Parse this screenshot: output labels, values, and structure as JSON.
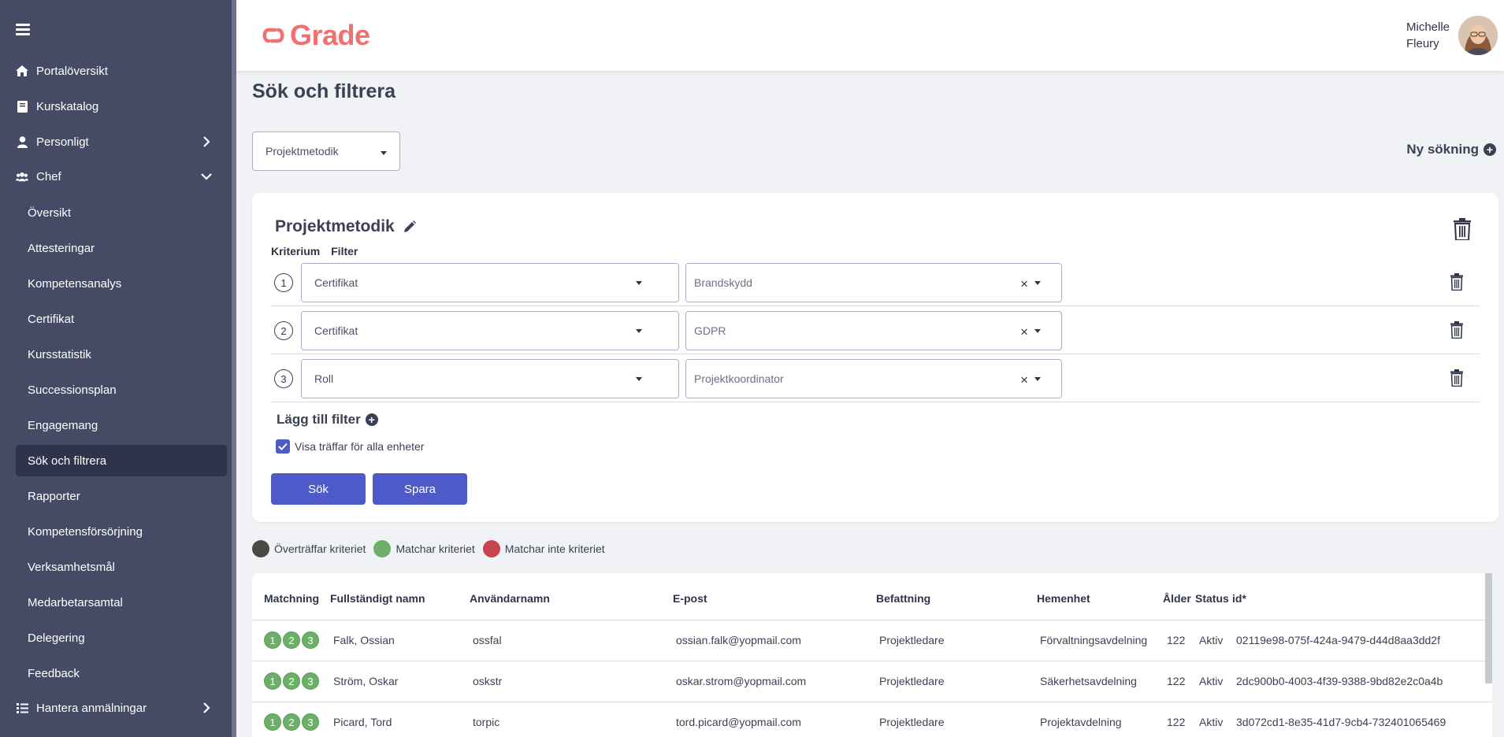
{
  "sidebar": {
    "items": [
      {
        "label": "Portalöversikt"
      },
      {
        "label": "Kurskatalog"
      },
      {
        "label": "Personligt"
      },
      {
        "label": "Chef"
      },
      {
        "label": "Hantera anmälningar"
      }
    ],
    "sub_items": [
      {
        "label": "Översikt"
      },
      {
        "label": "Attesteringar"
      },
      {
        "label": "Kompetensanalys"
      },
      {
        "label": "Certifikat"
      },
      {
        "label": "Kursstatistik"
      },
      {
        "label": "Successionsplan"
      },
      {
        "label": "Engagemang"
      },
      {
        "label": "Sök och filtrera"
      },
      {
        "label": "Rapporter"
      },
      {
        "label": "Kompetensförsörjning"
      },
      {
        "label": "Verksamhetsmål"
      },
      {
        "label": "Medarbetarsamtal"
      },
      {
        "label": "Delegering"
      },
      {
        "label": "Feedback"
      }
    ]
  },
  "header": {
    "logo_text": "Grade",
    "user_first": "Michelle",
    "user_last": "Fleury"
  },
  "page": {
    "title": "Sök och filtrera",
    "saved_search": "Projektmetodik",
    "new_search_label": "Ny sökning"
  },
  "filter_card": {
    "title": "Projektmetodik",
    "criterion_label": "Kriterium",
    "filter_label": "Filter",
    "rows": [
      {
        "num": "1",
        "criterion": "Certifikat",
        "filter": "Brandskydd"
      },
      {
        "num": "2",
        "criterion": "Certifikat",
        "filter": "GDPR"
      },
      {
        "num": "3",
        "criterion": "Roll",
        "filter": "Projektkoordinator"
      }
    ],
    "add_filter_label": "Lägg till filter",
    "show_all_units_label": "Visa träffar för alla enheter",
    "search_button": "Sök",
    "save_button": "Spara"
  },
  "legend": {
    "items": [
      {
        "label": "Överträffar kriteriet",
        "color": "#4a4a44"
      },
      {
        "label": "Matchar kriteriet",
        "color": "#6caf68"
      },
      {
        "label": "Matchar inte kriteriet",
        "color": "#c8434f"
      }
    ]
  },
  "table": {
    "headers": {
      "match": "Matchning",
      "name": "Fullständigt namn",
      "username": "Användarnamn",
      "email": "E-post",
      "position": "Befattning",
      "unit": "Hemenhet",
      "age": "Ålder",
      "status": "Status",
      "id": "id*"
    },
    "rows": [
      {
        "badges": [
          "1",
          "2",
          "3"
        ],
        "name": "Falk, Ossian",
        "username": "ossfal",
        "email": "ossian.falk@yopmail.com",
        "position": "Projektledare",
        "unit": "Förvaltningsavdelning",
        "age": "122",
        "status": "Aktiv",
        "id": "02119e98-075f-424a-9479-d44d8aa3dd2f"
      },
      {
        "badges": [
          "1",
          "2",
          "3"
        ],
        "name": "Ström, Oskar",
        "username": "oskstr",
        "email": "oskar.strom@yopmail.com",
        "position": "Projektledare",
        "unit": "Säkerhetsavdelning",
        "age": "122",
        "status": "Aktiv",
        "id": "2dc900b0-4003-4f39-9388-9bd82e2c0a4b"
      },
      {
        "badges": [
          "1",
          "2",
          "3"
        ],
        "name": "Picard, Tord",
        "username": "torpic",
        "email": "tord.picard@yopmail.com",
        "position": "Projektledare",
        "unit": "Projektavdelning",
        "age": "122",
        "status": "Aktiv",
        "id": "3d072cd1-8e35-41d7-9cb4-732401065469"
      }
    ]
  },
  "colors": {
    "sidebar": "#464b65",
    "accent": "#4e5ac8",
    "logo": "#f07070"
  }
}
